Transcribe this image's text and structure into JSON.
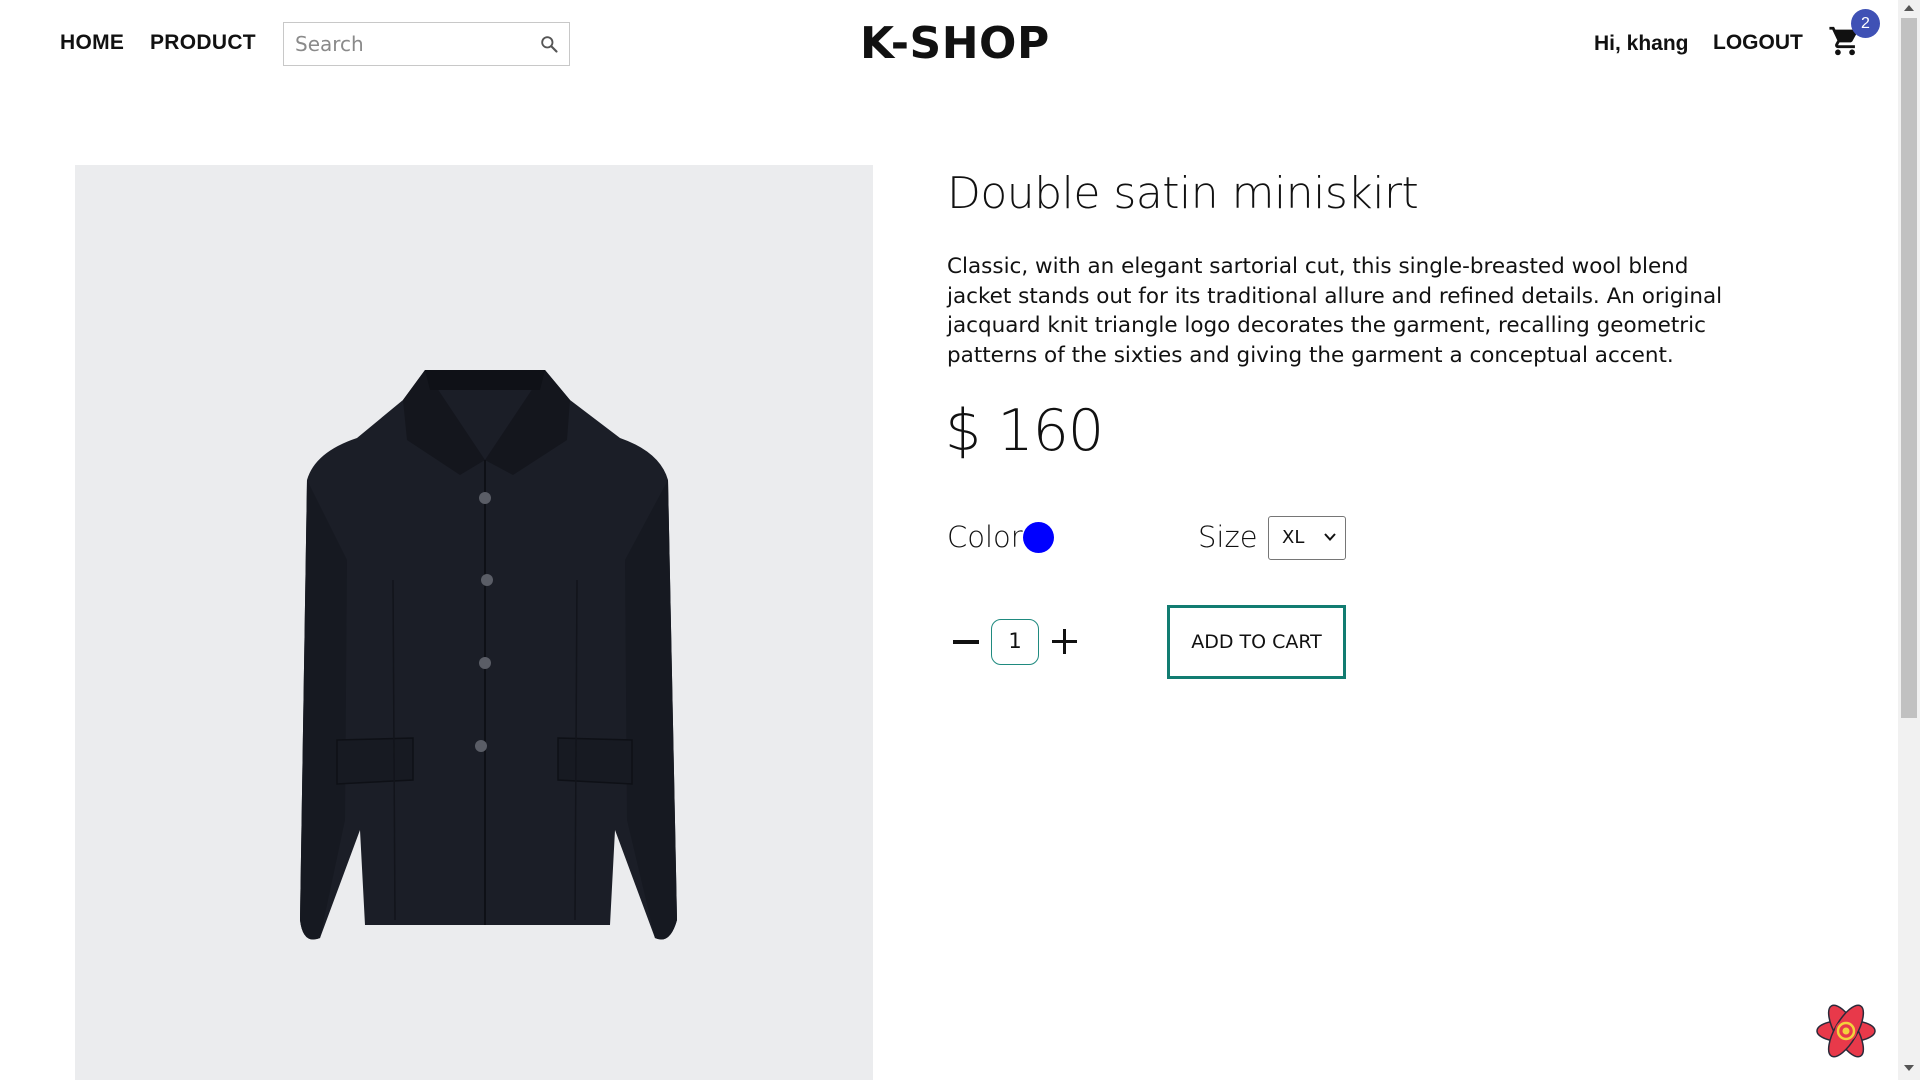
{
  "header": {
    "nav": [
      {
        "label": "HOME"
      },
      {
        "label": "PRODUCT"
      }
    ],
    "search": {
      "placeholder": "Search",
      "value": ""
    },
    "logo": "K-SHOP",
    "greeting": "Hi, khang",
    "logout_label": "LOGOUT",
    "cart_count": "2"
  },
  "product": {
    "title": "Double satin miniskirt",
    "description": "Classic, with an elegant sartorial cut, this single-breasted wool blend jacket stands out for its traditional allure and refined details. An original jacquard knit triangle logo decorates the garment, recalling geometric patterns of the sixties and giving the garment a conceptual accent.",
    "price": "$ 160",
    "color_label": "Color",
    "selected_color": "#0000ff",
    "size_label": "Size",
    "selected_size": "XL",
    "quantity": "1",
    "add_to_cart_label": "ADD TO CART"
  },
  "colors": {
    "accent_teal": "#127c71",
    "badge_blue": "#3f51b5",
    "image_background": "#ebecee"
  },
  "icons": [
    "search-icon",
    "cart-icon",
    "minus-icon",
    "plus-icon",
    "chevron-down-icon",
    "react-icon"
  ]
}
